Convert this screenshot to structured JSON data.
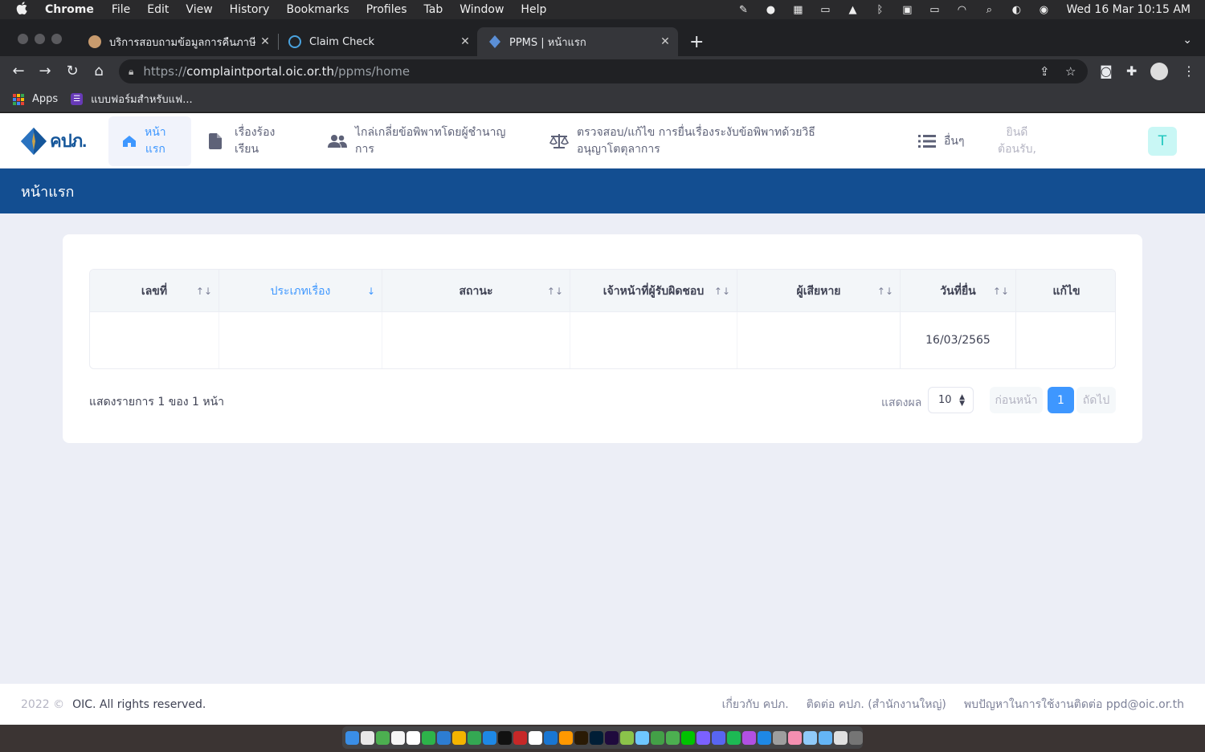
{
  "menubar": {
    "app": "Chrome",
    "items": [
      "File",
      "Edit",
      "View",
      "History",
      "Bookmarks",
      "Profiles",
      "Tab",
      "Window",
      "Help"
    ],
    "clock": "Wed 16 Mar  10:15 AM"
  },
  "tabs": [
    {
      "title": "บริการสอบถามข้อมูลการคืนภาษี | ก",
      "active": false
    },
    {
      "title": "Claim Check",
      "active": false
    },
    {
      "title": "PPMS | หน้าแรก",
      "active": true
    }
  ],
  "address": {
    "scheme": "https://",
    "host": "complaintportal.oic.or.th",
    "path": "/ppms/home"
  },
  "bookmarks": [
    {
      "label": "Apps"
    },
    {
      "label": "แบบฟอร์มสำหรับแฟ..."
    }
  ],
  "site": {
    "logo_text": "คปภ.",
    "nav": [
      {
        "label_line1": "หน้า",
        "label_line2": "แรก",
        "icon": "home-icon",
        "active": true
      },
      {
        "label_line1": "เรื่องร้อง",
        "label_line2": "เรียน",
        "icon": "file-icon",
        "active": false
      },
      {
        "label_line1": "ไกล่เกลี่ยข้อพิพาทโดยผู้ชำนาญ",
        "label_line2": "การ",
        "icon": "users-icon",
        "active": false
      },
      {
        "label_line1": "ตรวจสอบ/แก้ไข การยื่นเรื่องระงับข้อพิพาทด้วยวิธี",
        "label_line2": "อนุญาโตตุลาการ",
        "icon": "scale-icon",
        "active": false
      },
      {
        "label_line1": "อื่นๆ",
        "label_line2": "",
        "icon": "list-icon",
        "active": false
      }
    ],
    "welcome_line1": "ยินดี",
    "welcome_line2": "ต้อนรับ,",
    "avatar_letter": "T",
    "page_title": "หน้าแรก"
  },
  "table": {
    "columns": [
      {
        "label": "เลขที่",
        "sort": "↑↓",
        "sorted": false
      },
      {
        "label": "ประเภทเรื่อง",
        "sort": "↓",
        "sorted": true
      },
      {
        "label": "สถานะ",
        "sort": "↑↓",
        "sorted": false
      },
      {
        "label": "เจ้าหน้าที่ผู้รับผิดชอบ",
        "sort": "↑↓",
        "sorted": false
      },
      {
        "label": "ผู้เสียหาย",
        "sort": "↑↓",
        "sorted": false
      },
      {
        "label": "วันที่ยื่น",
        "sort": "↑↓",
        "sorted": false
      },
      {
        "label": "แก้ไข",
        "sort": "",
        "sorted": false
      }
    ],
    "rows": [
      [
        "",
        "",
        "",
        "",
        "",
        "16/03/2565",
        ""
      ]
    ]
  },
  "pagination": {
    "info": "แสดงรายการ 1 ของ 1 หน้า",
    "show_label": "แสดงผล",
    "page_size": "10",
    "prev_label": "ก่อนหน้า",
    "current_page": "1",
    "next_label": "ถัดไป"
  },
  "footer": {
    "year": "2022 ©",
    "owner": "OIC. All rights reserved.",
    "links": [
      "เกี่ยวกับ คปภ.",
      "ติดต่อ คปภ. (สำนักงานใหญ่)",
      "พบปัญหาในการใช้งานติดต่อ ppd@oic.or.th"
    ]
  },
  "colors": {
    "brand_blue": "#134e91",
    "accent": "#3e97ff",
    "avatar_bg": "#c9f7f5",
    "avatar_fg": "#1bc5bd"
  }
}
